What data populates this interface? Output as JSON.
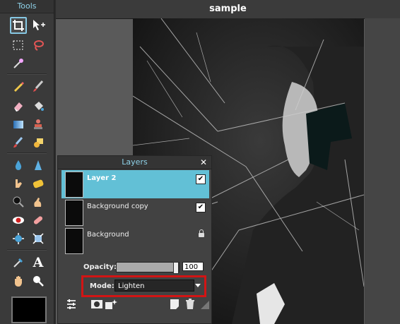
{
  "tools": {
    "title": "Tools",
    "items": [
      "crop-icon",
      "move-icon",
      "marquee-icon",
      "lasso-icon",
      "magic-wand-icon",
      "pencil-icon",
      "brush-icon",
      "eraser-icon",
      "bucket-icon",
      "gradient-icon",
      "clone-stamp-icon",
      "color-replace-icon",
      "draw-icon",
      "drop-icon",
      "sharpen-icon",
      "smudge-icon",
      "sponge-icon",
      "dodge-icon",
      "burn-icon",
      "red-eye-icon",
      "spot-heal-icon",
      "bloat-icon",
      "pinch-icon",
      "color-picker-icon",
      "type-icon",
      "hand-icon",
      "zoom-icon"
    ],
    "selected": "crop-icon",
    "foreground_color": "#000000"
  },
  "document": {
    "title": "sample"
  },
  "layers": {
    "title": "Layers",
    "items": [
      {
        "name": "Layer 2",
        "visible": true,
        "selected": true
      },
      {
        "name": "Background copy",
        "visible": true,
        "selected": false
      },
      {
        "name": "Background",
        "locked": true,
        "selected": false
      }
    ],
    "opacity_label": "Opacity:",
    "opacity_value": "100",
    "opacity_fraction": 1.0,
    "mode_label": "Mode:",
    "mode_value": "Lighten",
    "bottom_actions": [
      "layer-settings-icon",
      "layer-mask-icon",
      "layer-styles-icon",
      "new-layer-icon",
      "delete-layer-icon"
    ]
  },
  "colors": {
    "accent": "#62c0d6",
    "highlight": "#d21414",
    "tools_title": "#8fd3ea"
  }
}
